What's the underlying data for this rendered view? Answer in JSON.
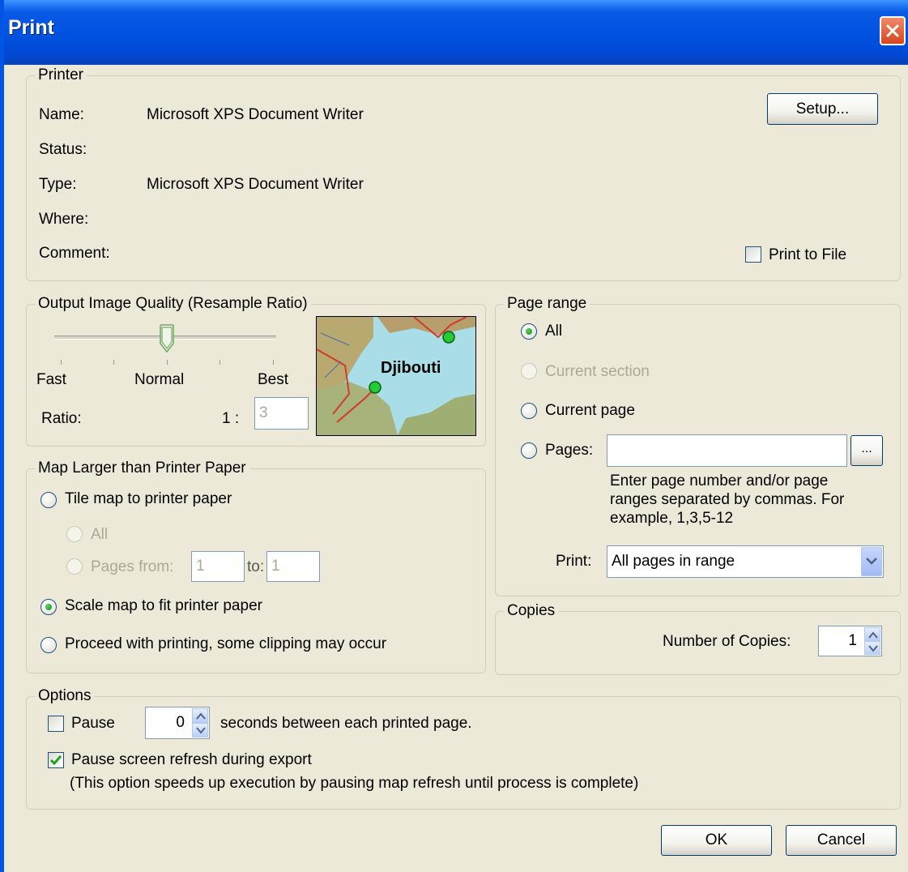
{
  "window": {
    "title": "Print"
  },
  "printer": {
    "group_label": "Printer",
    "name_label": "Name:",
    "name_value": "Microsoft XPS Document Writer",
    "status_label": "Status:",
    "type_label": "Type:",
    "type_value": "Microsoft XPS Document Writer",
    "where_label": "Where:",
    "comment_label": "Comment:",
    "setup_button": "Setup...",
    "print_to_file_label": "Print to File",
    "print_to_file_checked": false
  },
  "quality": {
    "group_label": "Output Image Quality (Resample Ratio)",
    "fast_label": "Fast",
    "normal_label": "Normal",
    "best_label": "Best",
    "ratio_label": "Ratio:",
    "ratio_prefix": "1 :",
    "ratio_value": "3",
    "slider_position": 0.5,
    "preview_place_label": "Djibouti"
  },
  "map_larger": {
    "group_label": "Map Larger than Printer Paper",
    "tile_label": "Tile map to printer paper",
    "tile_all_label": "All",
    "pages_from_label": "Pages from:",
    "pages_from_value": "1",
    "to_label": "to:",
    "to_value": "1",
    "scale_label": "Scale map to fit printer paper",
    "proceed_label": "Proceed with printing, some clipping may occur",
    "selected": "scale"
  },
  "page_range": {
    "group_label": "Page range",
    "all_label": "All",
    "current_section_label": "Current section",
    "current_page_label": "Current page",
    "pages_label": "Pages:",
    "pages_value": "",
    "browse_button": "...",
    "hint_line1": "Enter page number and/or page",
    "hint_line2": "ranges separated by commas.  For",
    "hint_line3": "example, 1,3,5-12",
    "print_label": "Print:",
    "print_selected": "All pages in range",
    "selected": "all"
  },
  "copies": {
    "group_label": "Copies",
    "number_label": "Number of Copies:",
    "number_value": "1"
  },
  "options": {
    "group_label": "Options",
    "pause_label": "Pause",
    "pause_checked": false,
    "pause_seconds": "0",
    "seconds_text": "seconds between each printed page.",
    "refresh_label": "Pause screen refresh during export",
    "refresh_checked": true,
    "refresh_note": "(This option speeds up execution by pausing map refresh until process is complete)"
  },
  "buttons": {
    "ok": "OK",
    "cancel": "Cancel"
  }
}
